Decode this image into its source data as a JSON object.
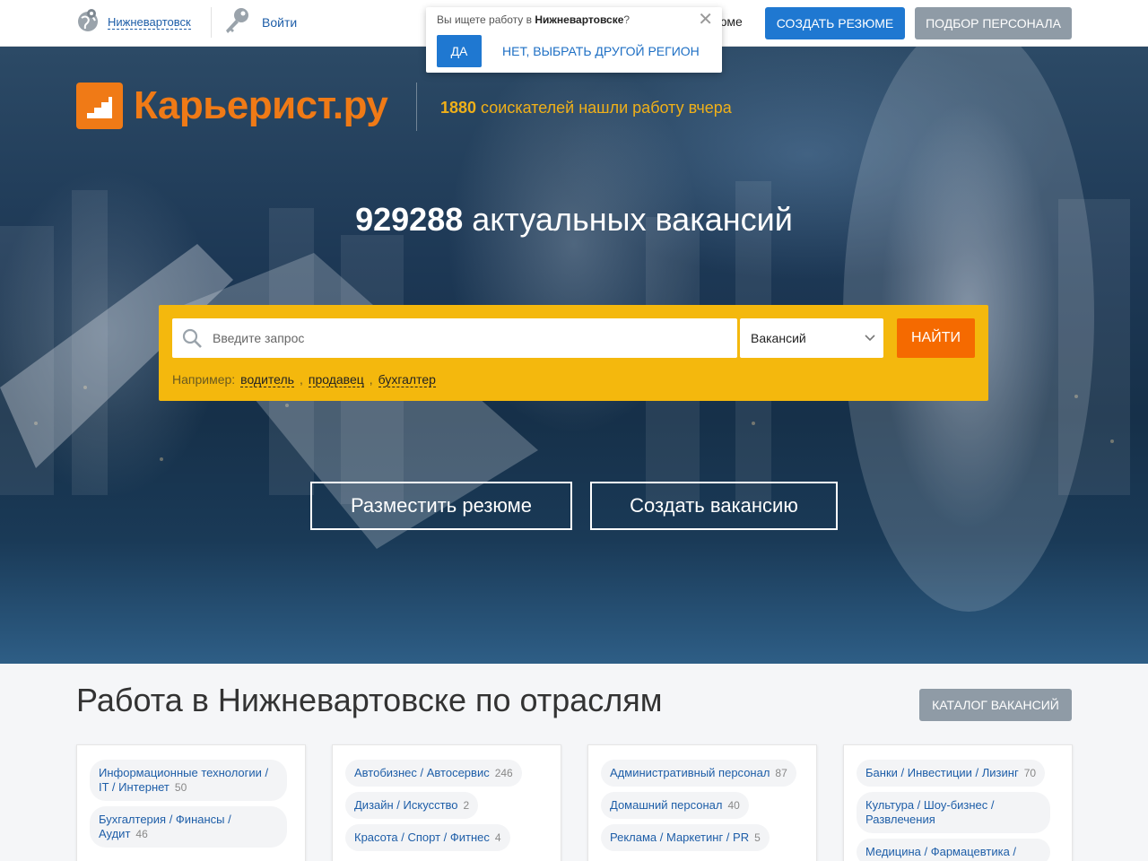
{
  "topbar": {
    "city": "Нижневартовск",
    "login": "Войти",
    "resume_partial": "юме",
    "create_resume": "СОЗДАТЬ РЕЗЮМЕ",
    "staff_search": "ПОДБОР ПЕРСОНАЛА"
  },
  "region_popup": {
    "question_prefix": "Вы ищете работу в ",
    "question_city": "Нижневартовске",
    "question_suffix": "?",
    "yes": "ДА",
    "no": "НЕТ, ВЫБРАТЬ ДРУГОЙ РЕГИОН"
  },
  "hero": {
    "logo_text": "Карьерист.ру",
    "tagline_count": "1880",
    "tagline_text": " соискателей нашли работу вчера",
    "vacancies_count": "929288",
    "vacancies_text": " актуальных вакансий",
    "search": {
      "placeholder": "Введите запрос",
      "select_value": "Вакансий",
      "button": "НАЙТИ",
      "examples_label": "Например:",
      "examples": [
        "водитель",
        "продавец",
        "бухгалтер"
      ]
    },
    "post_resume": "Разместить резюме",
    "create_vacancy": "Создать вакансию"
  },
  "sectors": {
    "title": "Работа в Нижневартовске по отраслям",
    "catalog_button": "КАТАЛОГ ВАКАНСИЙ",
    "columns": [
      [
        {
          "name": "Информационные технологии / IT / Интернет",
          "count": "50"
        },
        {
          "name": "Бухгалтерия / Финансы / Аудит",
          "count": "46"
        }
      ],
      [
        {
          "name": "Автобизнес / Автосервис",
          "count": "246"
        },
        {
          "name": "Дизайн / Искусство",
          "count": "2"
        },
        {
          "name": "Красота / Спорт / Фитнес",
          "count": "4"
        }
      ],
      [
        {
          "name": "Административный персонал",
          "count": "87"
        },
        {
          "name": "Домашний персонал",
          "count": "40"
        },
        {
          "name": "Реклама / Маркетинг / PR",
          "count": "5"
        }
      ],
      [
        {
          "name": "Банки / Инвестиции / Лизинг",
          "count": "70"
        },
        {
          "name": "Культура / Шоу-бизнес / Развлечения",
          "count": ""
        },
        {
          "name": "Медицина / Фармацевтика /",
          "count": ""
        }
      ]
    ]
  },
  "colors": {
    "brand_orange": "#f07a16",
    "primary_blue": "#1f78d1",
    "search_yellow": "#f4b80d",
    "find_orange": "#f56a00",
    "gray_button": "#8f9ba6"
  }
}
